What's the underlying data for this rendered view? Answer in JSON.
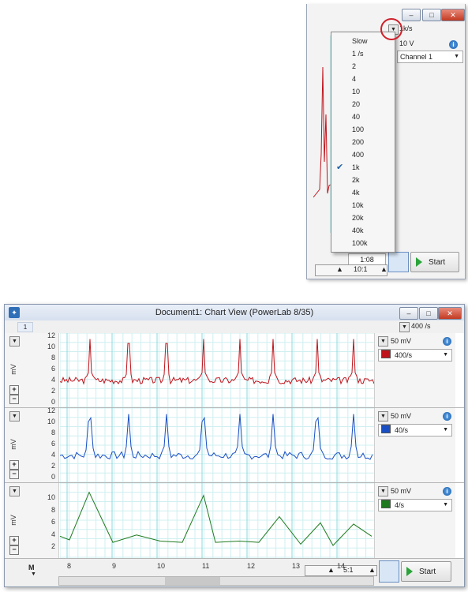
{
  "top_window": {
    "rate_value": "1k/s",
    "range_value": "10 V",
    "channel_select": "Channel 1",
    "time_field": "1:08",
    "zoom": "10:1",
    "start_label": "Start",
    "controls": {
      "min": "–",
      "max": "□",
      "close": "✕"
    }
  },
  "rate_dropdown": {
    "items": [
      "Slow",
      "1 /s",
      "2",
      "4",
      "10",
      "20",
      "40",
      "100",
      "200",
      "400",
      "1k",
      "2k",
      "4k",
      "10k",
      "20k",
      "40k",
      "100k"
    ],
    "selected": "1k"
  },
  "main_window": {
    "title": "Document1: Chart View (PowerLab 8/35)",
    "tab_label": "1",
    "rate": "400 /s",
    "controls": {
      "min": "–",
      "max": "□",
      "close": "✕"
    },
    "channels": [
      {
        "range": "50 mV",
        "rate": "400/s",
        "color": "#c0141c",
        "unit": "mV",
        "ticks": [
          "12",
          "10",
          "8",
          "6",
          "4",
          "2",
          "0"
        ]
      },
      {
        "range": "50 mV",
        "rate": "40/s",
        "color": "#1a4fc4",
        "unit": "mV",
        "ticks": [
          "12",
          "10",
          "8",
          "6",
          "4",
          "2",
          "0"
        ]
      },
      {
        "range": "50 mV",
        "rate": "4/s",
        "color": "#1f7a1f",
        "unit": "mV",
        "ticks": [
          "10",
          "8",
          "6",
          "4",
          "2"
        ]
      }
    ],
    "x_ticks": [
      "8",
      "9",
      "10",
      "11",
      "12",
      "13",
      "14"
    ],
    "zoom": "5:1",
    "start_label": "Start",
    "marker_label": "M"
  }
}
